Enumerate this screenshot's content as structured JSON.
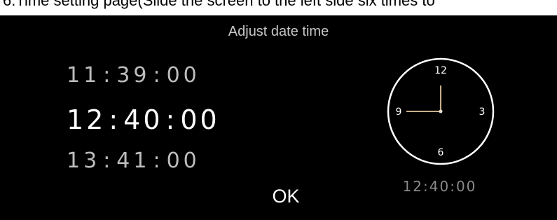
{
  "caption": {
    "text": "6.Time setting page(Slide the screen to the left side six times to"
  },
  "screen": {
    "title": "Adjust date time",
    "picker": {
      "previous": {
        "hours": "11",
        "minutes": "39",
        "seconds": "00"
      },
      "selected": {
        "hours": "12",
        "minutes": "40",
        "seconds": "00"
      },
      "next": {
        "hours": "13",
        "minutes": "41",
        "seconds": "00"
      },
      "separator": ":"
    },
    "ok_label": "OK",
    "clock": {
      "numerals": {
        "twelve": "12",
        "three": "3",
        "six": "6",
        "nine": "9"
      },
      "time_readout": "12:40:00",
      "hand_color": "#c8b08a",
      "face_color": "#ffffff"
    }
  }
}
